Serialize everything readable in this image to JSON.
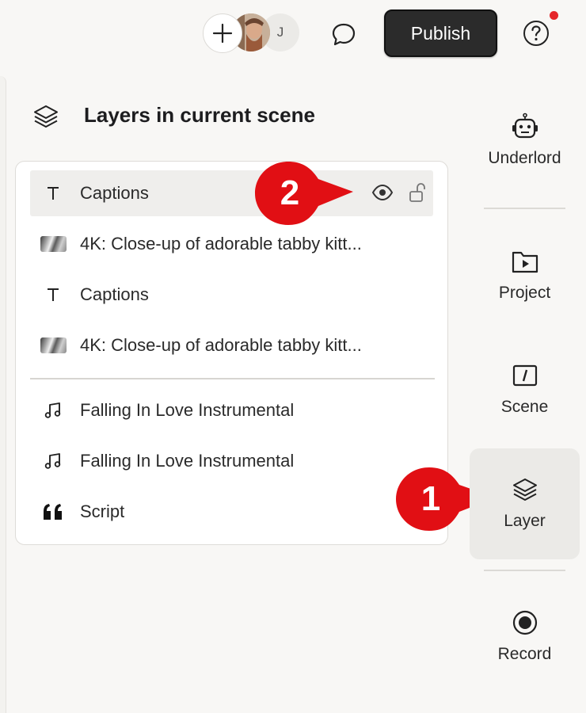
{
  "topbar": {
    "avatar_initial": "J",
    "publish_label": "Publish"
  },
  "panel": {
    "title": "Layers in current scene",
    "layers": [
      {
        "type": "text",
        "label": "Captions",
        "selected": true
      },
      {
        "type": "video",
        "label": "4K: Close-up of adorable tabby kitt..."
      },
      {
        "type": "text",
        "label": "Captions"
      },
      {
        "type": "video",
        "label": "4K: Close-up of adorable tabby kitt..."
      }
    ],
    "audio_layers": [
      {
        "type": "audio",
        "label": "Falling In Love Instrumental"
      },
      {
        "type": "audio",
        "label": "Falling In Love Instrumental"
      },
      {
        "type": "script",
        "label": "Script"
      }
    ]
  },
  "callouts": {
    "one": "1",
    "two": "2",
    "color": "#e10f14"
  },
  "sidebar": {
    "items": [
      {
        "label": "Underlord"
      },
      {
        "label": "Project"
      },
      {
        "label": "Scene"
      },
      {
        "label": "Layer",
        "active": true
      },
      {
        "label": "Record"
      }
    ]
  },
  "colors": {
    "background": "#f8f7f5",
    "publish_bg": "#2b2b2b",
    "notification": "#e5262a",
    "selected_row": "#efeeec"
  }
}
